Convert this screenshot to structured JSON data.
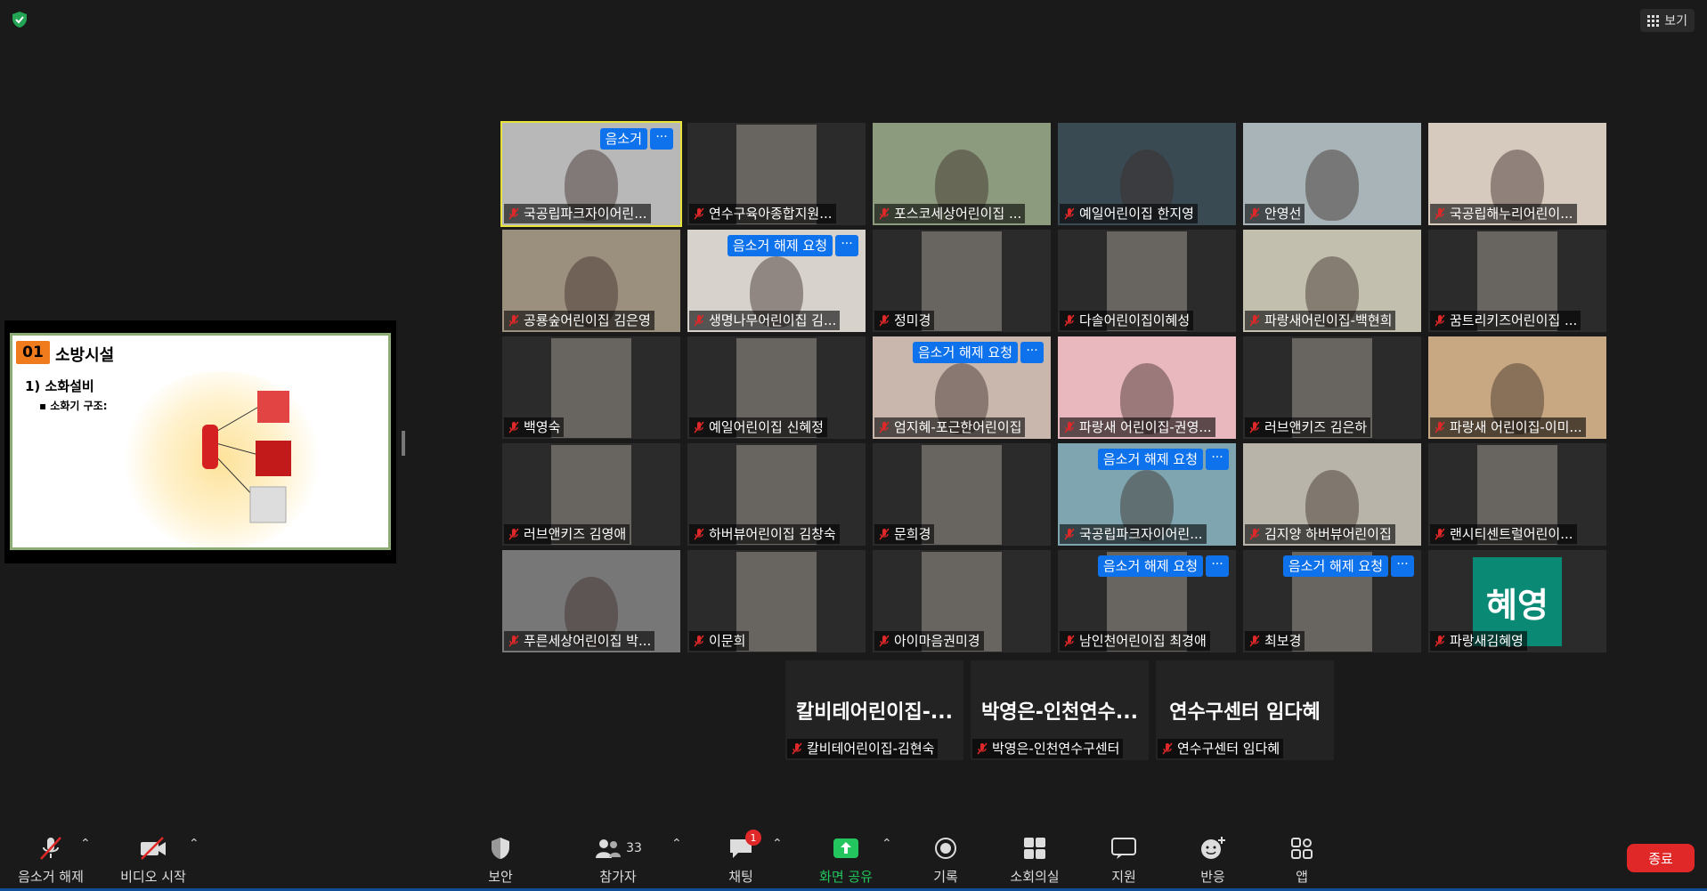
{
  "header": {
    "view_label": "보기"
  },
  "share": {
    "slide_num": "01",
    "slide_title": "소방시설",
    "slide_sub": "1) 소화설비",
    "slide_bullet": "▪ 소화기 구조:"
  },
  "tiles": [
    {
      "name": "국공립파크자이어린...",
      "tag": "음소거",
      "active": true,
      "bg": "#b8b8b8"
    },
    {
      "name": "연수구육아종합지원...",
      "tag": "",
      "bg": "#2b2b2b"
    },
    {
      "name": "포스코세상어린이집 ...",
      "tag": "",
      "bg": "#8c9a7e"
    },
    {
      "name": "예일어린이집 한지영",
      "tag": "",
      "bg": "#3a4a52"
    },
    {
      "name": "안영선",
      "tag": "",
      "bg": "#a9b4b8"
    },
    {
      "name": "국공립해누리어린이...",
      "tag": "",
      "bg": "#d6c9bd"
    },
    {
      "name": "공룡숲어린이집 김은영",
      "tag": "",
      "bg": "#9b8f7e"
    },
    {
      "name": "생명나무어린이집 김...",
      "tag": "음소거 해제 요청",
      "bg": "#d8d2cc"
    },
    {
      "name": "정미경",
      "tag": "",
      "bg": "#2b2b2b"
    },
    {
      "name": "다솔어린이집이혜성",
      "tag": "",
      "bg": "#2b2b2b"
    },
    {
      "name": "파랑새어린이집-백현희",
      "tag": "",
      "bg": "#c2bfae"
    },
    {
      "name": "꿈트리키즈어린이집 ...",
      "tag": "",
      "bg": "#2b2b2b"
    },
    {
      "name": "백영숙",
      "tag": "",
      "bg": "#2b2b2b"
    },
    {
      "name": "예일어린이집 신혜정",
      "tag": "",
      "bg": "#2b2b2b"
    },
    {
      "name": "엄지혜-포근한어린이집",
      "tag": "음소거 해제 요청",
      "bg": "#c9b6ad"
    },
    {
      "name": "파랑새 어린이집-권영...",
      "tag": "",
      "bg": "#e9b7be"
    },
    {
      "name": "러브앤키즈 김은하",
      "tag": "",
      "bg": "#2b2b2b"
    },
    {
      "name": "파랑새 어린이집-이미...",
      "tag": "",
      "bg": "#c8a882"
    },
    {
      "name": "러브앤키즈 김영애",
      "tag": "",
      "bg": "#2b2b2b"
    },
    {
      "name": "하버뷰어린이집 김창숙",
      "tag": "",
      "bg": "#2b2b2b"
    },
    {
      "name": "문희경",
      "tag": "",
      "bg": "#2b2b2b"
    },
    {
      "name": "국공립파크자이어린...",
      "tag": "음소거 해제 요청",
      "bg": "#7fa6b0"
    },
    {
      "name": "김지양 하버뷰어린이집",
      "tag": "",
      "bg": "#b9b4aa"
    },
    {
      "name": "랜시티센트럴어린이...",
      "tag": "",
      "bg": "#2b2b2b"
    },
    {
      "name": "푸른세상어린이집 박...",
      "tag": "",
      "bg": "#777"
    },
    {
      "name": "이문희",
      "tag": "",
      "bg": "#2b2b2b"
    },
    {
      "name": "아이마음권미경",
      "tag": "",
      "bg": "#2b2b2b"
    },
    {
      "name": "남인천어린이집 최경애",
      "tag": "음소거 해제 요청",
      "bg": "#2b2b2b"
    },
    {
      "name": "최보경",
      "tag": "음소거 해제 요청",
      "bg": "#2b2b2b"
    },
    {
      "name": "파랑새김혜영",
      "tag": "",
      "avatar": "혜영",
      "bg": "#2b2b2b"
    }
  ],
  "audio_tiles": [
    {
      "big": "칼비테어린이집-...",
      "name": "칼비테어린이집-김현숙"
    },
    {
      "big": "박영은-인천연수...",
      "name": "박영은-인천연수구센터"
    },
    {
      "big": "연수구센터 임다혜",
      "name": "연수구센터 임다혜"
    }
  ],
  "toolbar": {
    "unmute": "음소거 해제",
    "video": "비디오 시작",
    "security": "보안",
    "participants": "참가자",
    "participants_count": "33",
    "chat": "채팅",
    "chat_badge": "1",
    "share": "화면 공유",
    "record": "기록",
    "breakout": "소회의실",
    "support": "지원",
    "reactions": "반응",
    "apps": "앱",
    "end": "종료"
  },
  "colors": {
    "accent": "#0e72ed",
    "active_speaker": "#e8e43a",
    "end": "#e02828",
    "share_green": "#22c55e"
  }
}
